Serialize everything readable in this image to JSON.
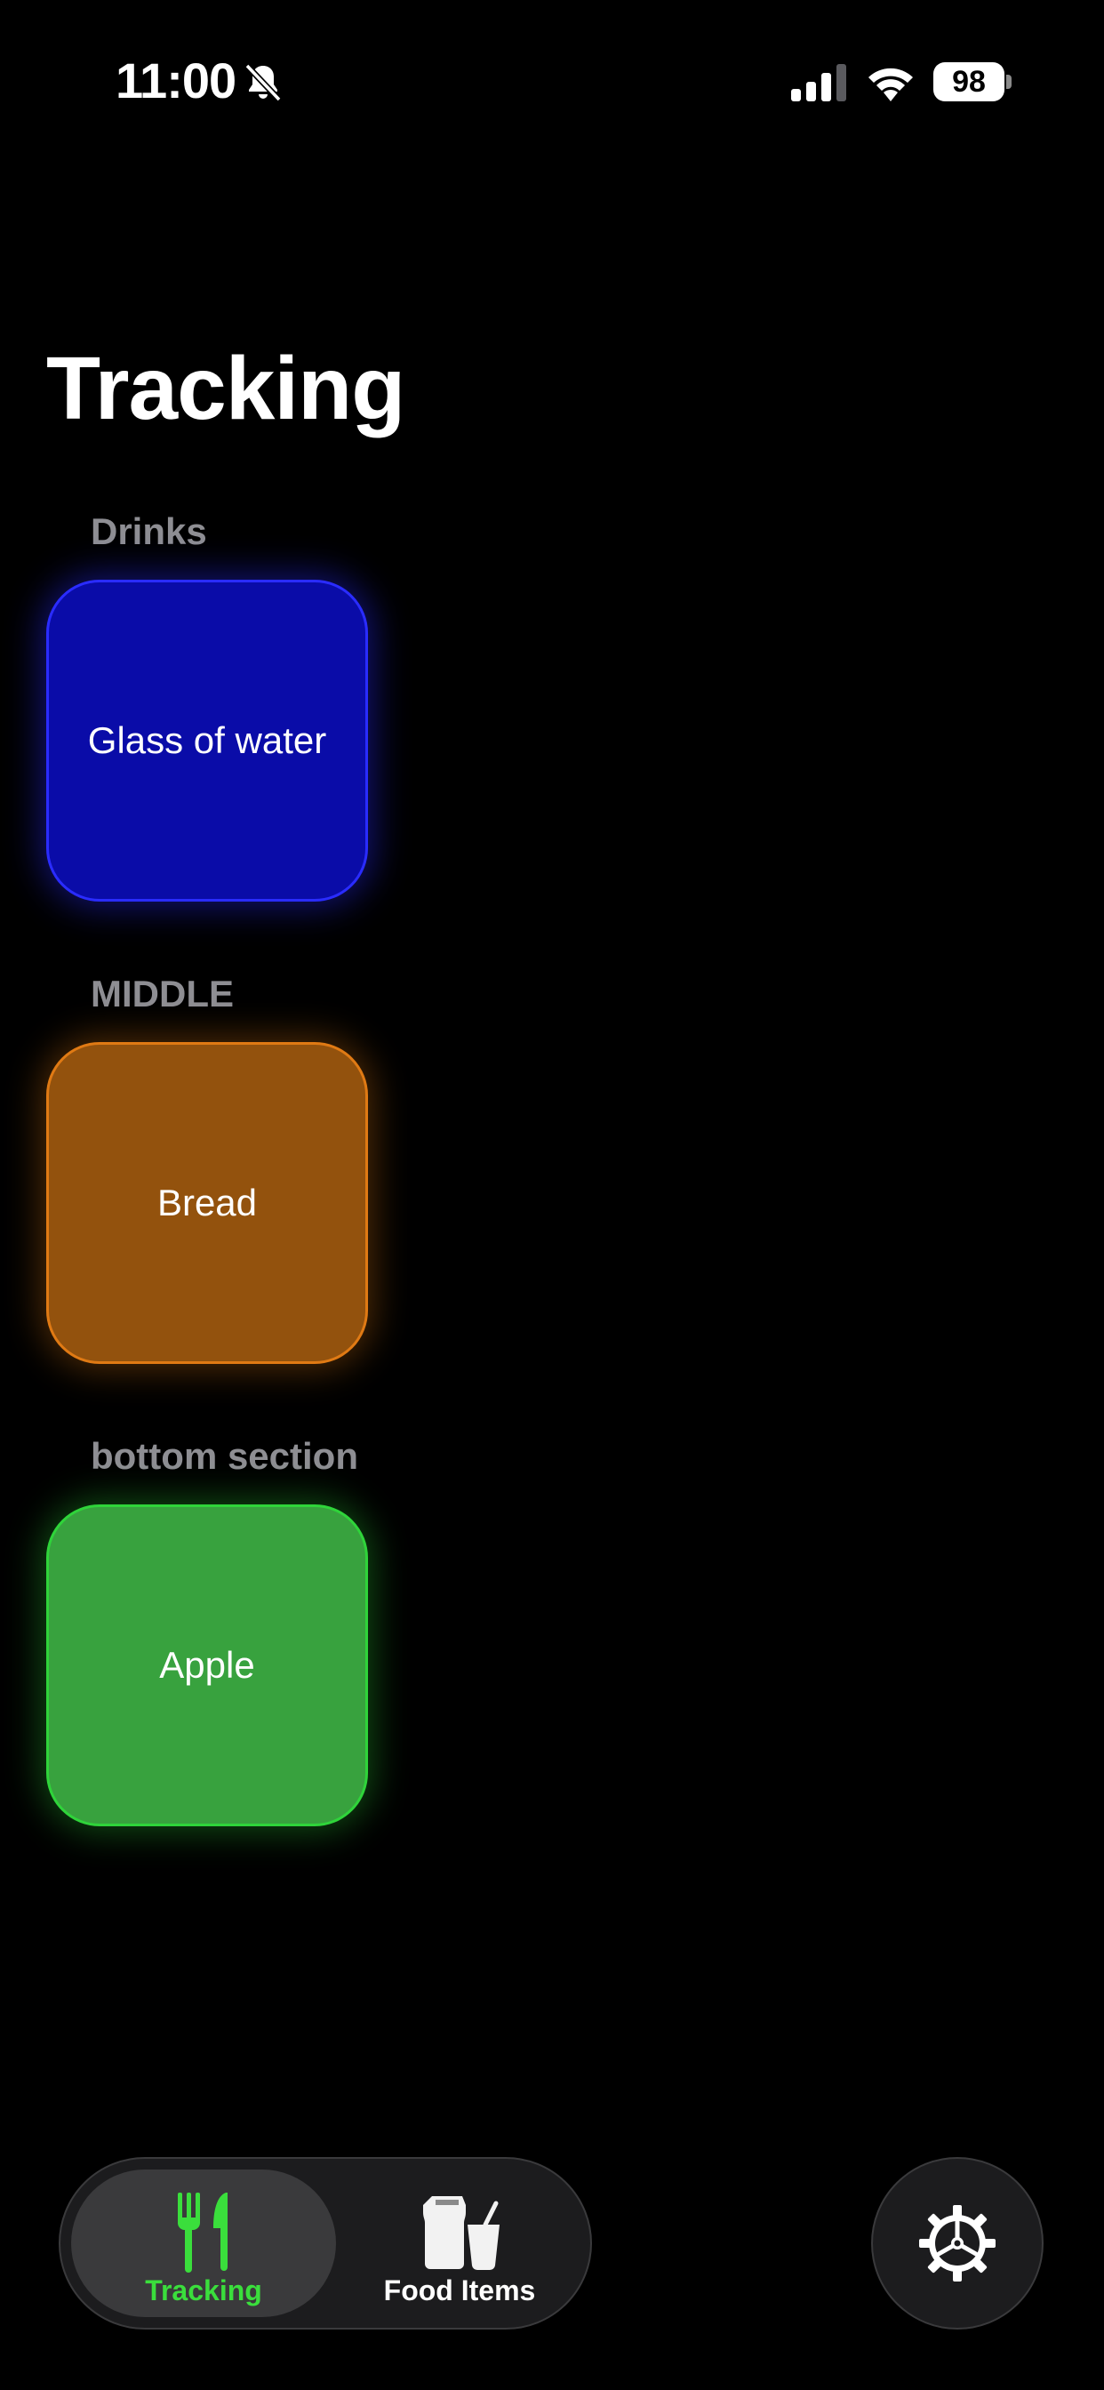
{
  "status_bar": {
    "time": "11:00",
    "battery_level": "98",
    "icons": [
      "bell-slash-icon",
      "cellular-signal-icon",
      "wifi-icon",
      "battery-icon"
    ]
  },
  "page": {
    "title": "Tracking"
  },
  "sections": [
    {
      "label": "Drinks",
      "item": "Glass of water",
      "color": "#0a0ca8"
    },
    {
      "label": "MIDDLE",
      "item": "Bread",
      "color": "#93520d"
    },
    {
      "label": "bottom section",
      "item": "Apple",
      "color": "#38a23e"
    }
  ],
  "tab_bar": {
    "tabs": [
      {
        "label": "Tracking",
        "icon": "fork-knife-icon",
        "selected": true,
        "color": "#3ade3c"
      },
      {
        "label": "Food Items",
        "icon": "food-items-icon",
        "selected": false,
        "color": "#ffffff"
      }
    ]
  },
  "settings": {
    "icon": "gear-icon"
  }
}
